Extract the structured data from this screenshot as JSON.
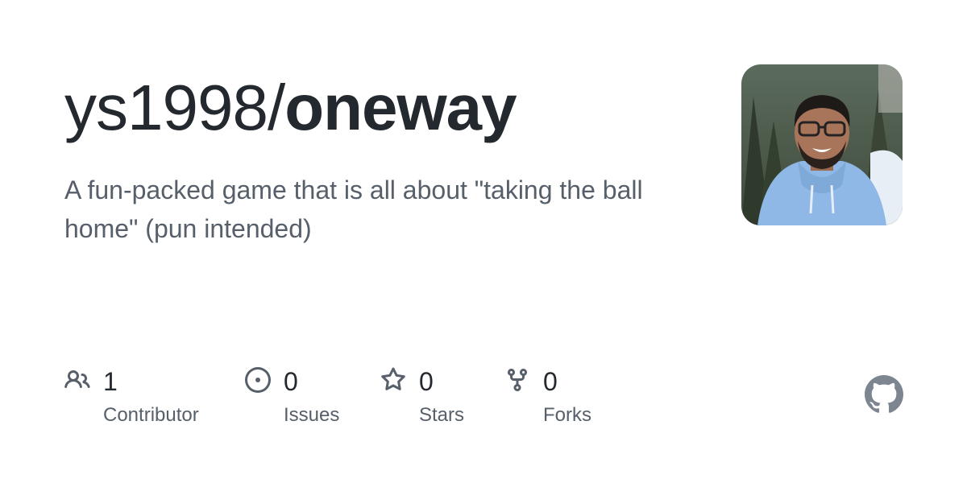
{
  "repo": {
    "owner": "ys1998/",
    "name": "oneway",
    "description": "A fun-packed game that is all about \"taking the ball home\" (pun intended)"
  },
  "stats": {
    "contributors": {
      "count": "1",
      "label": "Contributor",
      "icon": "people-icon"
    },
    "issues": {
      "count": "0",
      "label": "Issues",
      "icon": "issue-opened-icon"
    },
    "stars": {
      "count": "0",
      "label": "Stars",
      "icon": "star-icon"
    },
    "forks": {
      "count": "0",
      "label": "Forks",
      "icon": "repo-forked-icon"
    }
  },
  "branding": {
    "logo_icon": "github-mark-icon"
  },
  "colors": {
    "title": "#24292f",
    "muted": "#57606a",
    "icon": "#57606a",
    "logo": "#7d8590"
  }
}
